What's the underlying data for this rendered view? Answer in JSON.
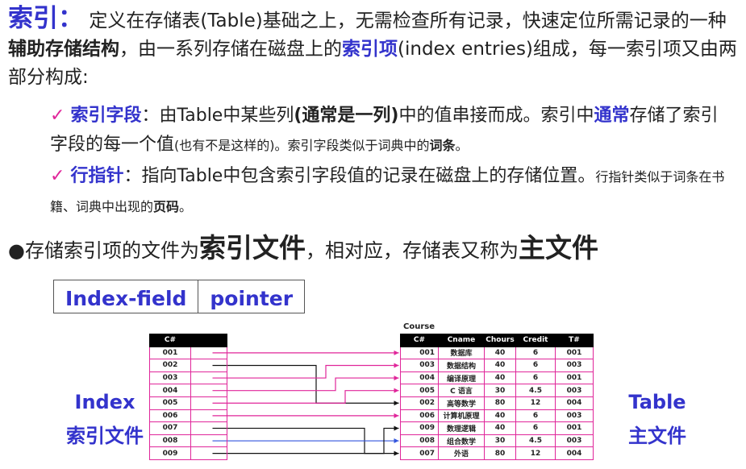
{
  "intro": {
    "title": "索引：",
    "text1": "定义在存储表(Table)基础之上，无需检查所有记录，快速定位所需记录的一种",
    "bold1": "辅助存储结构",
    "text2": "，由一系列存储在磁盘上的",
    "term": "索引项",
    "text3": "(index entries)组成，每一索引项又由两部分构成:"
  },
  "bullets": {
    "b1_check": "✓",
    "b1_label": "索引字段",
    "b1_t1": "：由Table中某些列",
    "b1_bold": "(通常是一列)",
    "b1_t2": "中的值串接而成。索引中",
    "b1_bold2": "通常",
    "b1_t3": "存储了索引字段的每一个值",
    "b1_small1": "(也有不是这样的)。索引字段类似于词典中的",
    "b1_small_bold": "词条",
    "b1_small2": "。",
    "b2_check": "✓",
    "b2_label": "行指针",
    "b2_t1": "：指向Table中包含索引字段值的记录在磁盘上的存储位置。",
    "b2_small1": "行指针类似于词条在书籍、词典中出现的",
    "b2_small_bold": "页码",
    "b2_small2": "。"
  },
  "para2": {
    "dot": "●",
    "t1": "存储索引项的文件为",
    "big1": "索引文件",
    "t2": "，相对应，存储表又称为",
    "big2": "主文件"
  },
  "fields": [
    "Index-field",
    "pointer"
  ],
  "index_table": {
    "header": "C#",
    "rows": [
      "001",
      "002",
      "003",
      "004",
      "005",
      "006",
      "007",
      "008",
      "009"
    ]
  },
  "course_table": {
    "title": "Course",
    "headers": [
      "C#",
      "Cname",
      "Chours",
      "Credit",
      "T#"
    ],
    "rows": [
      [
        "001",
        "数据库",
        "40",
        "6",
        "001"
      ],
      [
        "003",
        "数据结构",
        "40",
        "6",
        "003"
      ],
      [
        "004",
        "编译原理",
        "40",
        "6",
        "001"
      ],
      [
        "005",
        "C 语言",
        "30",
        "4.5",
        "003"
      ],
      [
        "002",
        "高等数学",
        "80",
        "12",
        "004"
      ],
      [
        "006",
        "计算机原理",
        "40",
        "6",
        "003"
      ],
      [
        "009",
        "数理逻辑",
        "40",
        "6",
        "001"
      ],
      [
        "008",
        "组合数学",
        "30",
        "4.5",
        "003"
      ],
      [
        "007",
        "外语",
        "80",
        "12",
        "004"
      ]
    ]
  },
  "labels": {
    "left1": "Index",
    "left2": "索引文件",
    "right1": "Table",
    "right2": "主文件"
  }
}
